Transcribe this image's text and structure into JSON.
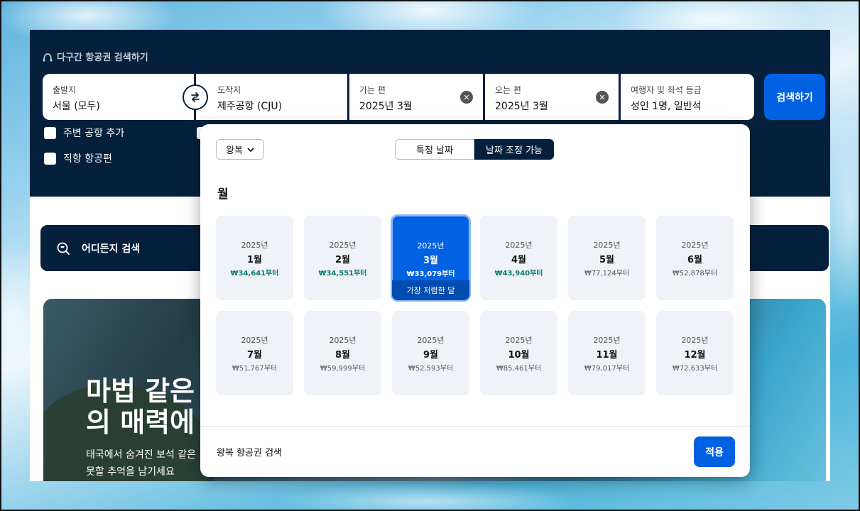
{
  "header": {
    "multi_city": "다구간 항공권 검색하기"
  },
  "search": {
    "origin": {
      "label": "출발지",
      "value": "서울 (모두)"
    },
    "destination": {
      "label": "도착지",
      "value": "제주공항 (CJU)"
    },
    "depart": {
      "label": "가는 편",
      "value": "2025년 3월"
    },
    "return": {
      "label": "오는 편",
      "value": "2025년 3월"
    },
    "travellers": {
      "label": "여행자 및 좌석 등급",
      "value": "성인 1명, 일반석"
    },
    "button": "검색하기"
  },
  "options": {
    "nearby": "주변 공항 추가",
    "direct": "직항 항공편"
  },
  "explore": "어디든지 검색",
  "promo": {
    "heading_1": "마법 같은",
    "heading_2": "의 매력에",
    "sub_1": "태국에서 숨겨진 보석 같은",
    "sub_2": "못할 추억을 남기세요"
  },
  "picker": {
    "trip_type": "왕복",
    "tab_specific": "특정 날짜",
    "tab_flexible": "날짜 조정 가능",
    "heading": "월",
    "months": [
      {
        "year": "2025년",
        "month": "1월",
        "price": "₩34,641부터",
        "cheap": true
      },
      {
        "year": "2025년",
        "month": "2월",
        "price": "₩34,551부터",
        "cheap": true
      },
      {
        "year": "2025년",
        "month": "3월",
        "price": "₩33,079부터",
        "cheap": true,
        "selected": true,
        "tag": "가장 저렴한 달"
      },
      {
        "year": "2025년",
        "month": "4월",
        "price": "₩43,940부터",
        "cheap": true
      },
      {
        "year": "2025년",
        "month": "5월",
        "price": "₩77,124부터"
      },
      {
        "year": "2025년",
        "month": "6월",
        "price": "₩52,878부터"
      },
      {
        "year": "2025년",
        "month": "7월",
        "price": "₩51,767부터"
      },
      {
        "year": "2025년",
        "month": "8월",
        "price": "₩59,999부터"
      },
      {
        "year": "2025년",
        "month": "9월",
        "price": "₩52,593부터"
      },
      {
        "year": "2025년",
        "month": "10월",
        "price": "₩85,461부터"
      },
      {
        "year": "2025년",
        "month": "11월",
        "price": "₩79,017부터"
      },
      {
        "year": "2025년",
        "month": "12월",
        "price": "₩72,633부터"
      }
    ],
    "footer_text": "왕복 항공권 검색",
    "apply": "적용"
  }
}
